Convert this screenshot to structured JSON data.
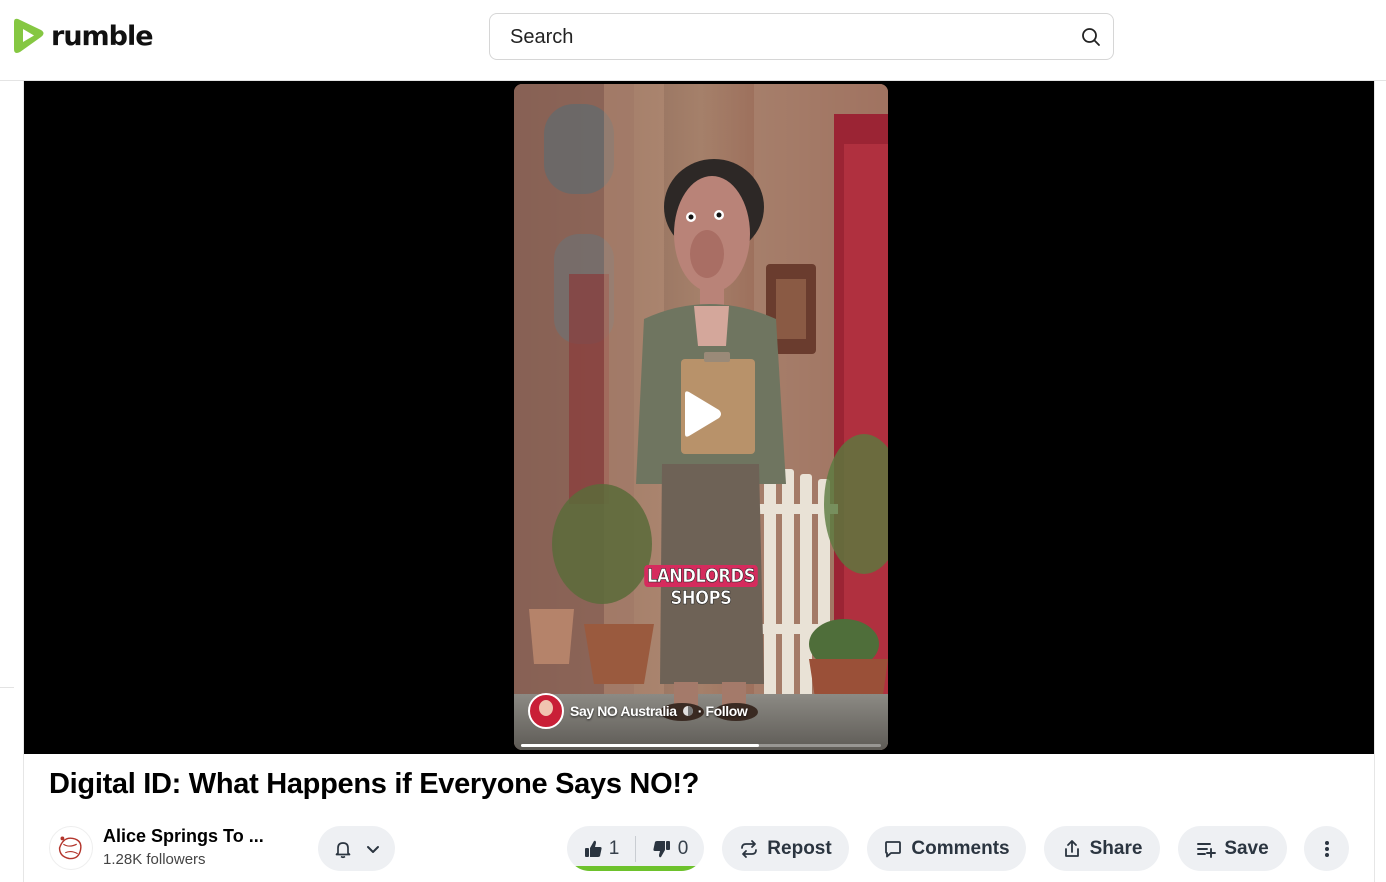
{
  "header": {
    "logo_text": "rumble",
    "brand_color": "#85c742",
    "search_placeholder": "Search"
  },
  "player": {
    "caption_highlight": "LANDLORDS",
    "caption_rest": "SHOPS",
    "overlay_author": "Say NO Australia",
    "overlay_follow": "· Follow",
    "progress_fraction": 0.66,
    "play_icon": "play-icon"
  },
  "video": {
    "title": "Digital ID: What Happens if Everyone Says NO!?"
  },
  "channel": {
    "name": "Alice Springs To ...",
    "followers": "1.28K followers"
  },
  "actions": {
    "likes": "1",
    "dislikes": "0",
    "repost": "Repost",
    "comments": "Comments",
    "share": "Share",
    "save": "Save",
    "vote_bar_color": "#6dc22c"
  }
}
